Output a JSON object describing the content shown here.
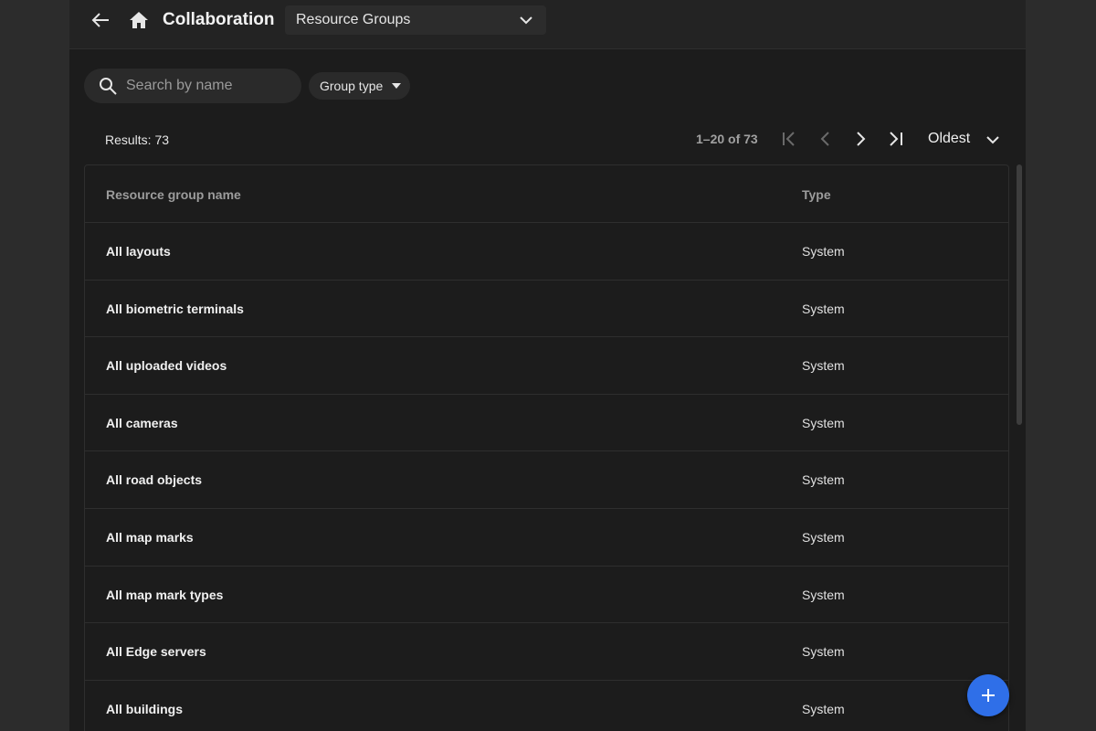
{
  "header": {
    "title": "Collaboration",
    "section_select": {
      "value": "Resource Groups"
    }
  },
  "filters": {
    "search_placeholder": "Search by name",
    "group_type_label": "Group type"
  },
  "pagination": {
    "results_label": "Results: 73",
    "range_label": "1–20 of 73",
    "sort_label": "Oldest"
  },
  "table": {
    "columns": [
      "Resource group name",
      "Type"
    ],
    "rows": [
      {
        "name": "All layouts",
        "type": "System"
      },
      {
        "name": "All biometric terminals",
        "type": "System"
      },
      {
        "name": "All uploaded videos",
        "type": "System"
      },
      {
        "name": "All cameras",
        "type": "System"
      },
      {
        "name": "All road objects",
        "type": "System"
      },
      {
        "name": "All map marks",
        "type": "System"
      },
      {
        "name": "All map mark types",
        "type": "System"
      },
      {
        "name": "All Edge servers",
        "type": "System"
      },
      {
        "name": "All buildings",
        "type": "System"
      }
    ]
  },
  "icons": {
    "back": "arrow-left-icon",
    "home": "home-icon",
    "search": "search-icon",
    "add": "plus-icon"
  },
  "colors": {
    "accent": "#2f6fe8",
    "background": "#1c1c1c"
  }
}
